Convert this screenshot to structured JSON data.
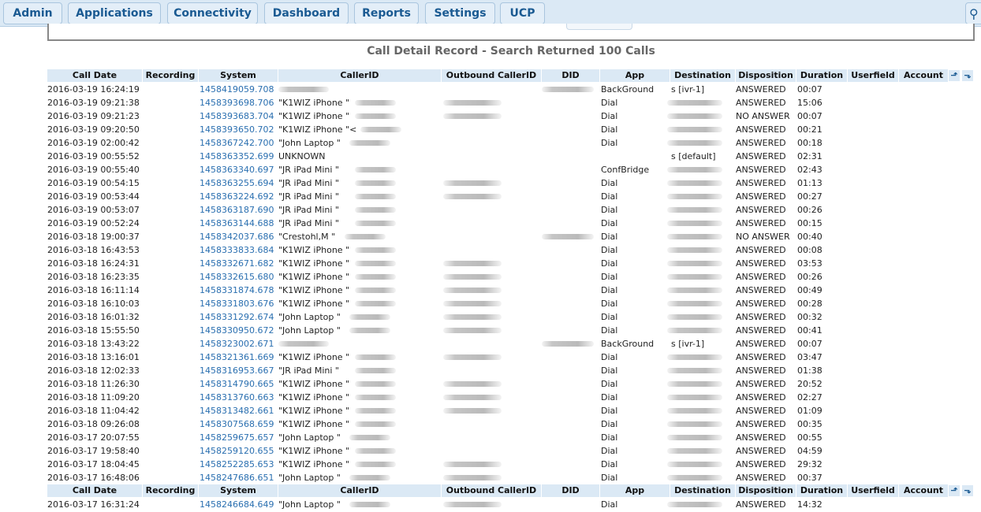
{
  "nav": {
    "items": [
      "Admin",
      "Applications",
      "Connectivity",
      "Dashboard",
      "Reports",
      "Settings",
      "UCP"
    ]
  },
  "report": {
    "title": "Call Detail Record - Search Returned 100 Calls"
  },
  "table": {
    "headers": [
      "Call Date",
      "Recording",
      "System",
      "CallerID",
      "Outbound CallerID",
      "DID",
      "App",
      "Destination",
      "Disposition",
      "Duration",
      "Userfield",
      "Account"
    ],
    "rows": [
      {
        "date": "2016-03-19 16:24:19",
        "system": "1458419059.708",
        "callerid": "",
        "cid_r": 1,
        "ocid_r": 0,
        "did_r": 1,
        "app": "BackGround",
        "dest": "s [ivr-1]",
        "dest_r": 0,
        "disp": "ANSWERED",
        "dur": "00:07"
      },
      {
        "date": "2016-03-19 09:21:38",
        "system": "1458393698.706",
        "callerid": "\"K1WIZ iPhone \"",
        "cid_r": 1,
        "ocid_r": 1,
        "did_r": 0,
        "app": "Dial",
        "dest": "",
        "dest_r": 1,
        "disp": "ANSWERED",
        "dur": "15:06"
      },
      {
        "date": "2016-03-19 09:21:23",
        "system": "1458393683.704",
        "callerid": "\"K1WIZ iPhone \"",
        "cid_r": 1,
        "ocid_r": 1,
        "did_r": 0,
        "app": "Dial",
        "dest": "",
        "dest_r": 1,
        "disp": "NO ANSWER",
        "dur": "00:07"
      },
      {
        "date": "2016-03-19 09:20:50",
        "system": "1458393650.702",
        "callerid": "\"K1WIZ iPhone \"<",
        "cid_r": 1,
        "ocid_r": 0,
        "did_r": 0,
        "app": "Dial",
        "dest": "",
        "dest_r": 1,
        "disp": "ANSWERED",
        "dur": "00:21"
      },
      {
        "date": "2016-03-19 02:00:42",
        "system": "1458367242.700",
        "callerid": "\"John Laptop \"",
        "cid_r": 1,
        "ocid_r": 0,
        "did_r": 0,
        "app": "Dial",
        "dest": "",
        "dest_r": 1,
        "disp": "ANSWERED",
        "dur": "00:18"
      },
      {
        "date": "2016-03-19 00:55:52",
        "system": "1458363352.699",
        "callerid": "UNKNOWN",
        "cid_r": 0,
        "ocid_r": 0,
        "did_r": 0,
        "app": "",
        "dest": "s [default]",
        "dest_r": 0,
        "disp": "ANSWERED",
        "dur": "02:31"
      },
      {
        "date": "2016-03-19 00:55:40",
        "system": "1458363340.697",
        "callerid": "\"JR iPad Mini \"",
        "cid_r": 1,
        "ocid_r": 0,
        "did_r": 0,
        "app": "ConfBridge",
        "dest": "",
        "dest_r": 1,
        "disp": "ANSWERED",
        "dur": "02:43"
      },
      {
        "date": "2016-03-19 00:54:15",
        "system": "1458363255.694",
        "callerid": "\"JR iPad Mini \"",
        "cid_r": 1,
        "ocid_r": 1,
        "did_r": 0,
        "app": "Dial",
        "dest": "",
        "dest_r": 1,
        "disp": "ANSWERED",
        "dur": "01:13"
      },
      {
        "date": "2016-03-19 00:53:44",
        "system": "1458363224.692",
        "callerid": "\"JR iPad Mini \"",
        "cid_r": 1,
        "ocid_r": 1,
        "did_r": 0,
        "app": "Dial",
        "dest": "",
        "dest_r": 1,
        "disp": "ANSWERED",
        "dur": "00:27"
      },
      {
        "date": "2016-03-19 00:53:07",
        "system": "1458363187.690",
        "callerid": "\"JR iPad Mini \"",
        "cid_r": 1,
        "ocid_r": 0,
        "did_r": 0,
        "app": "Dial",
        "dest": "",
        "dest_r": 1,
        "disp": "ANSWERED",
        "dur": "00:26"
      },
      {
        "date": "2016-03-19 00:52:24",
        "system": "1458363144.688",
        "callerid": "\"JR iPad Mini \"",
        "cid_r": 1,
        "ocid_r": 0,
        "did_r": 0,
        "app": "Dial",
        "dest": "",
        "dest_r": 1,
        "disp": "ANSWERED",
        "dur": "00:15"
      },
      {
        "date": "2016-03-18 19:00:37",
        "system": "1458342037.686",
        "callerid": "\"Crestohl,M \"",
        "cid_r": 1,
        "ocid_r": 0,
        "did_r": 1,
        "app": "Dial",
        "dest": "",
        "dest_r": 1,
        "disp": "NO ANSWER",
        "dur": "00:40"
      },
      {
        "date": "2016-03-18 16:43:53",
        "system": "1458333833.684",
        "callerid": "\"K1WIZ iPhone \"",
        "cid_r": 1,
        "ocid_r": 0,
        "did_r": 0,
        "app": "Dial",
        "dest": "",
        "dest_r": 1,
        "disp": "ANSWERED",
        "dur": "00:08"
      },
      {
        "date": "2016-03-18 16:24:31",
        "system": "1458332671.682",
        "callerid": "\"K1WIZ iPhone \"",
        "cid_r": 1,
        "ocid_r": 1,
        "did_r": 0,
        "app": "Dial",
        "dest": "",
        "dest_r": 1,
        "disp": "ANSWERED",
        "dur": "03:53"
      },
      {
        "date": "2016-03-18 16:23:35",
        "system": "1458332615.680",
        "callerid": "\"K1WIZ iPhone \"",
        "cid_r": 1,
        "ocid_r": 1,
        "did_r": 0,
        "app": "Dial",
        "dest": "",
        "dest_r": 1,
        "disp": "ANSWERED",
        "dur": "00:26"
      },
      {
        "date": "2016-03-18 16:11:14",
        "system": "1458331874.678",
        "callerid": "\"K1WIZ iPhone \"",
        "cid_r": 1,
        "ocid_r": 1,
        "did_r": 0,
        "app": "Dial",
        "dest": "",
        "dest_r": 1,
        "disp": "ANSWERED",
        "dur": "00:49"
      },
      {
        "date": "2016-03-18 16:10:03",
        "system": "1458331803.676",
        "callerid": "\"K1WIZ iPhone \"",
        "cid_r": 1,
        "ocid_r": 1,
        "did_r": 0,
        "app": "Dial",
        "dest": "",
        "dest_r": 1,
        "disp": "ANSWERED",
        "dur": "00:28"
      },
      {
        "date": "2016-03-18 16:01:32",
        "system": "1458331292.674",
        "callerid": "\"John Laptop \"",
        "cid_r": 1,
        "ocid_r": 1,
        "did_r": 0,
        "app": "Dial",
        "dest": "",
        "dest_r": 1,
        "disp": "ANSWERED",
        "dur": "00:32"
      },
      {
        "date": "2016-03-18 15:55:50",
        "system": "1458330950.672",
        "callerid": "\"John Laptop \"",
        "cid_r": 1,
        "ocid_r": 1,
        "did_r": 0,
        "app": "Dial",
        "dest": "",
        "dest_r": 1,
        "disp": "ANSWERED",
        "dur": "00:41"
      },
      {
        "date": "2016-03-18 13:43:22",
        "system": "1458323002.671",
        "callerid": "",
        "cid_r": 1,
        "ocid_r": 0,
        "did_r": 1,
        "app": "BackGround",
        "dest": "s [ivr-1]",
        "dest_r": 0,
        "disp": "ANSWERED",
        "dur": "00:07"
      },
      {
        "date": "2016-03-18 13:16:01",
        "system": "1458321361.669",
        "callerid": "\"K1WIZ iPhone \"",
        "cid_r": 1,
        "ocid_r": 1,
        "did_r": 0,
        "app": "Dial",
        "dest": "",
        "dest_r": 1,
        "disp": "ANSWERED",
        "dur": "03:47"
      },
      {
        "date": "2016-03-18 12:02:33",
        "system": "1458316953.667",
        "callerid": "\"JR iPad Mini \"",
        "cid_r": 1,
        "ocid_r": 0,
        "did_r": 0,
        "app": "Dial",
        "dest": "",
        "dest_r": 1,
        "disp": "ANSWERED",
        "dur": "01:38"
      },
      {
        "date": "2016-03-18 11:26:30",
        "system": "1458314790.665",
        "callerid": "\"K1WIZ iPhone \"",
        "cid_r": 1,
        "ocid_r": 1,
        "did_r": 0,
        "app": "Dial",
        "dest": "",
        "dest_r": 1,
        "disp": "ANSWERED",
        "dur": "20:52"
      },
      {
        "date": "2016-03-18 11:09:20",
        "system": "1458313760.663",
        "callerid": "\"K1WIZ iPhone \"",
        "cid_r": 1,
        "ocid_r": 1,
        "did_r": 0,
        "app": "Dial",
        "dest": "",
        "dest_r": 1,
        "disp": "ANSWERED",
        "dur": "02:27"
      },
      {
        "date": "2016-03-18 11:04:42",
        "system": "1458313482.661",
        "callerid": "\"K1WIZ iPhone \"",
        "cid_r": 1,
        "ocid_r": 1,
        "did_r": 0,
        "app": "Dial",
        "dest": "",
        "dest_r": 1,
        "disp": "ANSWERED",
        "dur": "01:09"
      },
      {
        "date": "2016-03-18 09:26:08",
        "system": "1458307568.659",
        "callerid": "\"K1WIZ iPhone \"",
        "cid_r": 1,
        "ocid_r": 0,
        "did_r": 0,
        "app": "Dial",
        "dest": "",
        "dest_r": 1,
        "disp": "ANSWERED",
        "dur": "00:35"
      },
      {
        "date": "2016-03-17 20:07:55",
        "system": "1458259675.657",
        "callerid": "\"John Laptop \"",
        "cid_r": 1,
        "ocid_r": 0,
        "did_r": 0,
        "app": "Dial",
        "dest": "",
        "dest_r": 1,
        "disp": "ANSWERED",
        "dur": "00:55"
      },
      {
        "date": "2016-03-17 19:58:40",
        "system": "1458259120.655",
        "callerid": "\"K1WIZ iPhone \"",
        "cid_r": 1,
        "ocid_r": 0,
        "did_r": 0,
        "app": "Dial",
        "dest": "",
        "dest_r": 1,
        "disp": "ANSWERED",
        "dur": "04:59"
      },
      {
        "date": "2016-03-17 18:04:45",
        "system": "1458252285.653",
        "callerid": "\"K1WIZ iPhone \"",
        "cid_r": 1,
        "ocid_r": 1,
        "did_r": 0,
        "app": "Dial",
        "dest": "",
        "dest_r": 1,
        "disp": "ANSWERED",
        "dur": "29:32"
      },
      {
        "date": "2016-03-17 16:48:06",
        "system": "1458247686.651",
        "callerid": "\"John Laptop \"",
        "cid_r": 1,
        "ocid_r": 1,
        "did_r": 0,
        "app": "Dial",
        "dest": "",
        "dest_r": 1,
        "disp": "ANSWERED",
        "dur": "00:37"
      }
    ],
    "rows2": [
      {
        "date": "2016-03-17 16:31:24",
        "system": "1458246684.649",
        "callerid": "\"John Laptop \"",
        "cid_r": 1,
        "ocid_r": 1,
        "did_r": 0,
        "app": "Dial",
        "dest": "",
        "dest_r": 1,
        "disp": "ANSWERED",
        "dur": "14:32"
      }
    ]
  },
  "icons": {
    "sort_up": "sort-ascending-icon",
    "sort_down": "sort-descending-icon",
    "search": "search-icon"
  },
  "colors": {
    "nav_bg": "#dbe9f5",
    "link": "#2a6fb0",
    "header_bg": "#dbe9f5"
  }
}
